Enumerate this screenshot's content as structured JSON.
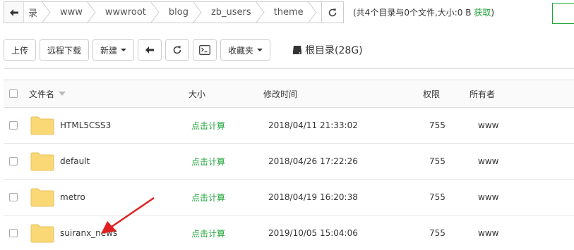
{
  "path": {
    "crumbs": [
      "录",
      "www",
      "wwwroot",
      "blog",
      "zb_users",
      "theme"
    ],
    "summary_text": "(共4个目录与0个文件,大小:0 B",
    "summary_link": "获取",
    "summary_close": ")"
  },
  "toolbar": {
    "upload": "上传",
    "remote_download": "远程下载",
    "new": "新建",
    "favorites": "收藏夹",
    "disk_label": "根目录(28G)"
  },
  "table": {
    "headers": {
      "name": "文件名",
      "size": "大小",
      "mtime": "修改时间",
      "perm": "权限",
      "owner": "所有者"
    },
    "rows": [
      {
        "name": "HTML5CSS3",
        "size": "点击计算",
        "mtime": "2018/04/11 21:33:02",
        "perm": "755",
        "owner": "www"
      },
      {
        "name": "default",
        "size": "点击计算",
        "mtime": "2018/04/26 17:22:26",
        "perm": "755",
        "owner": "www"
      },
      {
        "name": "metro",
        "size": "点击计算",
        "mtime": "2018/04/19 16:20:38",
        "perm": "755",
        "owner": "www"
      },
      {
        "name": "suiranx_news",
        "size": "点击计算",
        "mtime": "2019/10/05 15:04:06",
        "perm": "755",
        "owner": "www"
      }
    ]
  },
  "colors": {
    "accent": "#20a53a",
    "folder": "#fad876",
    "annotation_arrow": "#e02020"
  },
  "icons": [
    "arrow-left-icon",
    "refresh-icon",
    "terminal-icon",
    "disk-icon",
    "folder-icon",
    "caret-down-icon"
  ]
}
